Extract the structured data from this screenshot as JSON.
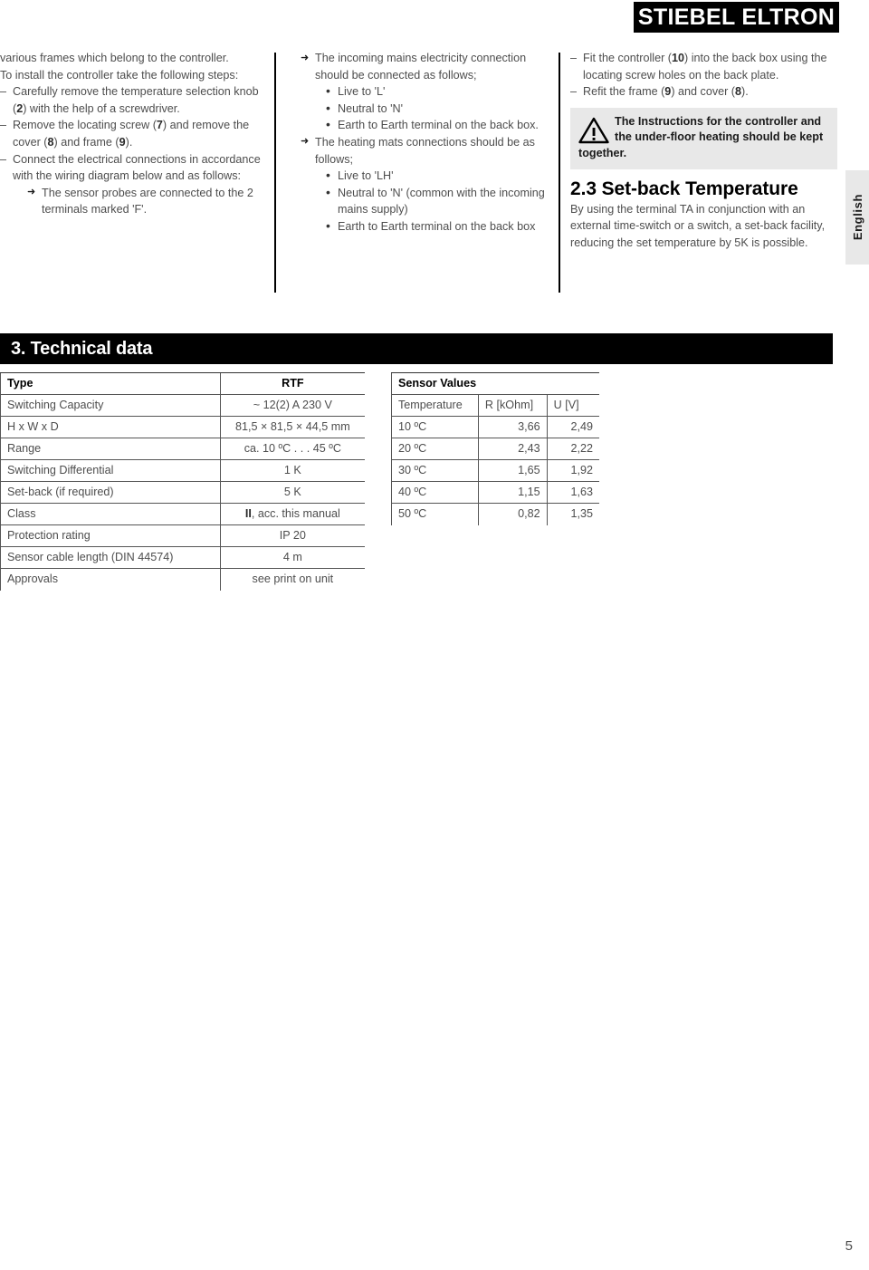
{
  "brand": {
    "name": "STIEBEL ELTRON"
  },
  "side_tab": {
    "label": "English"
  },
  "page": {
    "number": "5"
  },
  "columns": {
    "left": {
      "intro_1": "various frames which belong to the controller.",
      "intro_2": "To install the controller take the following steps:",
      "steps": [
        "Carefully remove the temperature selection knob (2) with the help of a screwdriver.",
        "Remove the locating screw (7) and remove the cover (8) and frame (9).",
        "Connect the electrical connections in accordance with the wiring diagram below and as follows:"
      ],
      "substep": "The sensor probes are connected to the 2 terminals marked 'F'."
    },
    "middle": {
      "item_1": {
        "text": "The incoming mains electricity connection should be connected as follows;",
        "bullets": [
          "Live to 'L'",
          "Neutral to 'N'",
          "Earth to Earth terminal on the back box."
        ]
      },
      "item_2": {
        "text": "The heating mats connections should be as follows;",
        "bullets": [
          "Live to 'LH'",
          "Neutral to 'N' (common with the incoming mains supply)",
          "Earth to Earth terminal on the back box"
        ]
      }
    },
    "right": {
      "steps": [
        "Fit the controller (10) into the back box using the locating screw holes on the back plate.",
        "Refit the frame (9) and cover (8)."
      ],
      "warning": {
        "icon": "warning-triangle-icon",
        "text": "The Instructions for the controller and the under-floor heating should be kept together."
      },
      "section_23": {
        "title": "2.3 Set-back Temperature",
        "body": "By using the terminal TA in conjunction with an external time-switch or a switch, a set-back facility, reducing the set temperature by 5K is possible."
      }
    }
  },
  "section3": {
    "title": "3. Technical data",
    "spec_table": {
      "header": {
        "label": "Type",
        "value": "RTF"
      },
      "rows": [
        {
          "label": "Switching Capacity",
          "value": "~ 12(2) A  230 V"
        },
        {
          "label": "H x W x D",
          "value": "81,5 × 81,5 × 44,5 mm"
        },
        {
          "label": "Range",
          "value": "ca. 10 ºC . . . 45 ºC"
        },
        {
          "label": "Switching Differential",
          "value": "1 K"
        },
        {
          "label": "Set-back (if required)",
          "value": "5 K"
        },
        {
          "label": "Class",
          "value": "II, acc. this manual"
        },
        {
          "label": "Protection rating",
          "value": "IP 20"
        },
        {
          "label": "Sensor cable length (DIN 44574)",
          "value": "4 m"
        },
        {
          "label": "Approvals",
          "value": "see print on unit"
        }
      ]
    },
    "sensor_table": {
      "title": "Sensor Values",
      "headers": [
        "Temperature",
        "R [kOhm]",
        "U [V]"
      ],
      "rows": [
        [
          "10 ºC",
          "3,66",
          "2,49"
        ],
        [
          "20 ºC",
          "2,43",
          "2,22"
        ],
        [
          "30 ºC",
          "1,65",
          "1,92"
        ],
        [
          "40 ºC",
          "1,15",
          "1,63"
        ],
        [
          "50 ºC",
          "0,82",
          "1,35"
        ]
      ]
    }
  },
  "colors": {
    "brand_bg": "#000000",
    "warning_bg": "#e8e8e8",
    "text": "#4d4d4d"
  }
}
